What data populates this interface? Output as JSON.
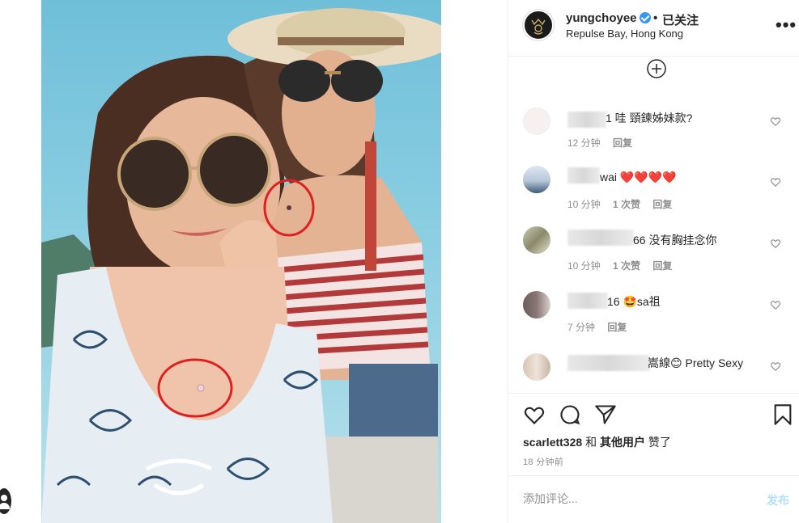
{
  "post": {
    "username": "yungchoyee",
    "separator": "•",
    "follow_status": "已关注",
    "location": "Repulse Bay, Hong Kong",
    "verified_icon": "verified-badge-icon",
    "more_icon": "more-options-icon",
    "load_more_icon": "plus-circle-icon"
  },
  "comments": [
    {
      "text": "1 哇 頸鍊姊妹款?",
      "time": "12 分钟",
      "likes": "",
      "reply": "回复"
    },
    {
      "text": "wai ❤️❤️❤️❤️",
      "time": "10 分钟",
      "likes": "1 次赞",
      "reply": "回复"
    },
    {
      "text": "66 没有胸挂念你",
      "time": "10 分钟",
      "likes": "1 次赞",
      "reply": "回复"
    },
    {
      "text": "16 🤩sa祖",
      "time": "7 分钟",
      "likes": "",
      "reply": "回复"
    },
    {
      "text": "嵩線😊 Pretty Sexy",
      "time": "",
      "likes": "",
      "reply": ""
    }
  ],
  "actions": {
    "like_icon": "heart-icon",
    "comment_icon": "comment-bubble-icon",
    "share_icon": "paper-plane-icon",
    "save_icon": "bookmark-icon"
  },
  "likes_line": {
    "first_user": "scarlett328",
    "conjunction": "和",
    "others": "其他用户",
    "suffix": "赞了"
  },
  "post_time": "18 分钟前",
  "add_comment": {
    "placeholder": "添加评论...",
    "post_label": "发布"
  },
  "colors": {
    "accent": "#3897f0",
    "post_button_disabled": "#b2dffc",
    "secondary_text": "#8e8e8e",
    "highlight_circle": "#e02020"
  }
}
